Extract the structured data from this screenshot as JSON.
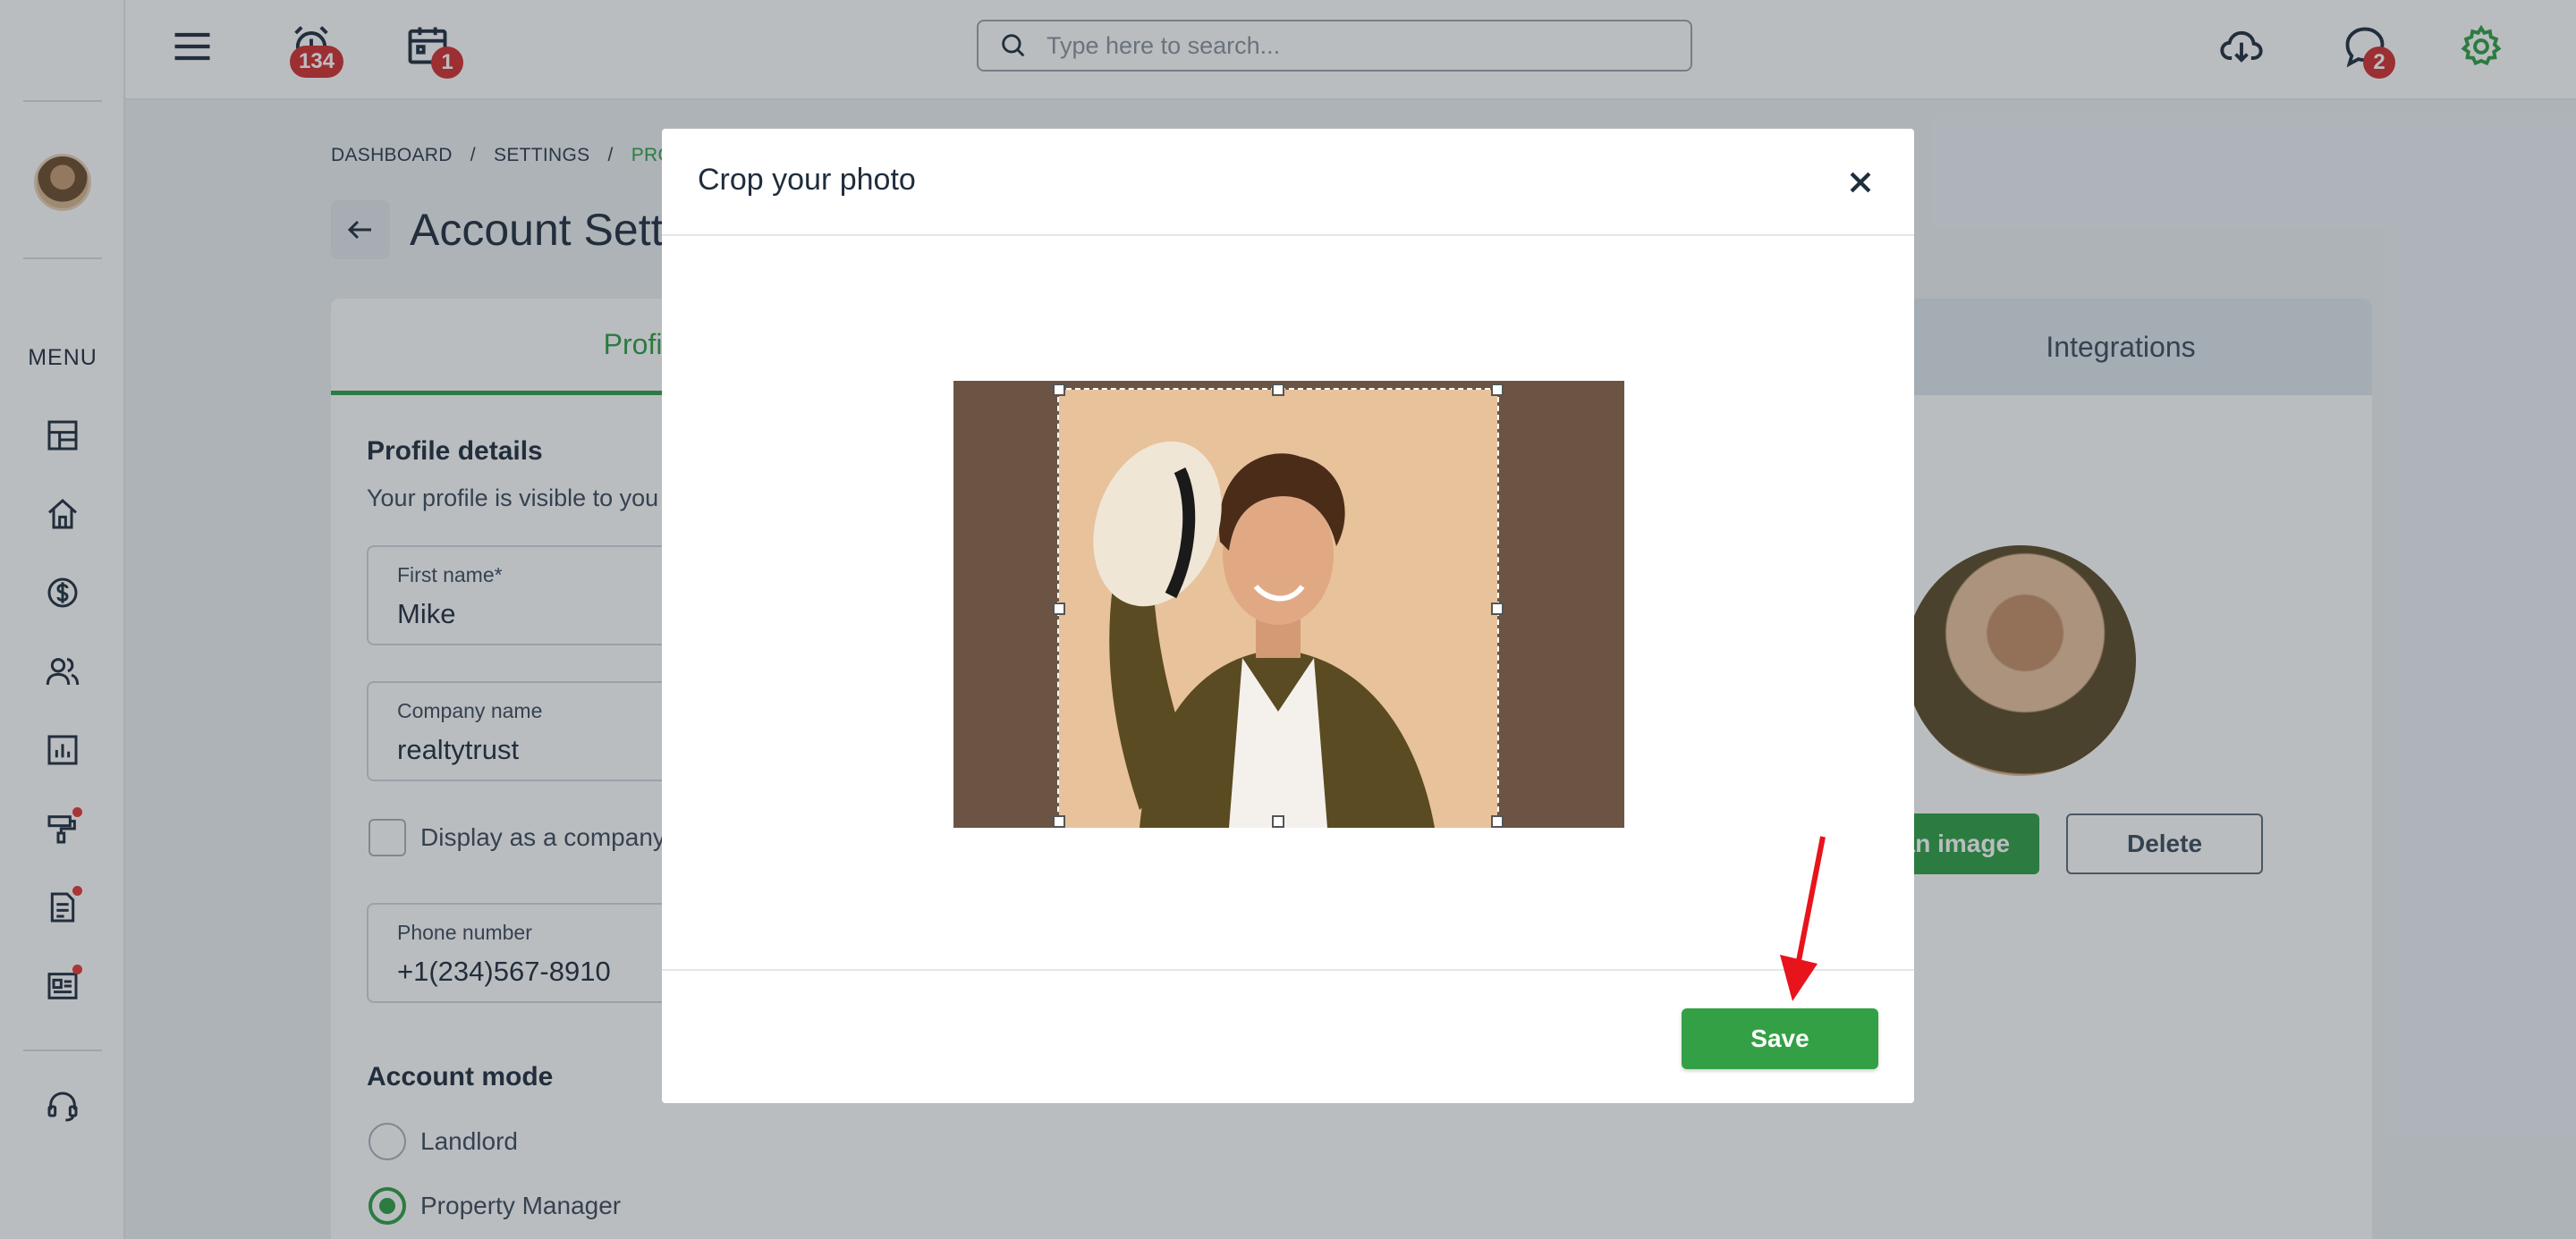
{
  "topbar": {
    "alarm_badge": "134",
    "calendar_badge": "1",
    "chat_badge": "2",
    "search": {
      "placeholder": "Type here to search..."
    }
  },
  "sidebar": {
    "menu_label": "MENU",
    "items": [
      {
        "icon": "dashboard-icon"
      },
      {
        "icon": "home-icon"
      },
      {
        "icon": "dollar-icon"
      },
      {
        "icon": "users-icon"
      },
      {
        "icon": "chart-icon"
      },
      {
        "icon": "tools-icon",
        "dot": true
      },
      {
        "icon": "document-icon",
        "dot": true
      },
      {
        "icon": "news-icon",
        "dot": true
      },
      {
        "icon": "support-icon"
      }
    ]
  },
  "breadcrumb": {
    "items": [
      "DASHBOARD",
      "SETTINGS",
      "PROFILE"
    ]
  },
  "page": {
    "title": "Account Settings",
    "tabs": [
      {
        "label": "Profile",
        "active": true
      },
      {
        "label": "Integrations",
        "active": false
      }
    ],
    "profile_details": {
      "title": "Profile details",
      "subtitle": "Your profile is visible to you",
      "first_name": {
        "label": "First name*",
        "value": "Mike"
      },
      "company_name": {
        "label": "Company name",
        "value": "realtytrust"
      },
      "display_as_company": "Display as a company?",
      "phone": {
        "label": "Phone number",
        "value": "+1(234)567-8910"
      }
    },
    "account_mode": {
      "title": "Account mode",
      "options": [
        {
          "label": "Landlord",
          "selected": false
        },
        {
          "label": "Property Manager",
          "selected": true
        }
      ]
    },
    "photo_actions": {
      "upload_label": "Upload an image",
      "delete_label": "Delete"
    }
  },
  "modal": {
    "title": "Crop your photo",
    "save_label": "Save"
  },
  "colors": {
    "accent": "#2e9e44",
    "badge": "#d32f2f",
    "annotation": "#e8141c"
  }
}
